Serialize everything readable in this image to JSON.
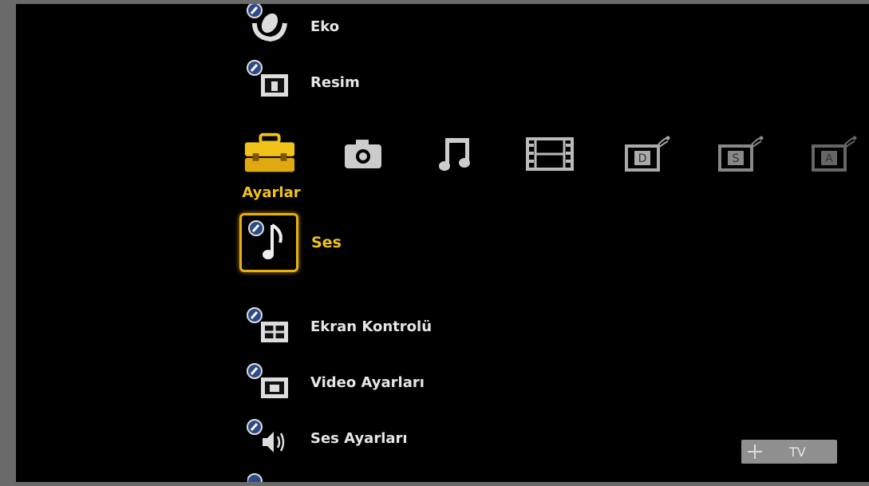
{
  "menu": {
    "items_above": [
      {
        "label": "Eko",
        "icon": "eco-leaf-icon"
      },
      {
        "label": "Resim",
        "icon": "picture-icon"
      }
    ],
    "selected": {
      "label": "Ses",
      "icon": "music-note-icon"
    },
    "items_below": [
      {
        "label": "Ekran Kontrolü",
        "icon": "screen-control-icon"
      },
      {
        "label": "Video Ayarları",
        "icon": "video-settings-icon"
      },
      {
        "label": "Ses Ayarları",
        "icon": "speaker-icon"
      }
    ]
  },
  "categories": {
    "active_label": "Ayarlar",
    "items": [
      {
        "name": "settings-toolbox-icon"
      },
      {
        "name": "camera-icon"
      },
      {
        "name": "music-icon"
      },
      {
        "name": "film-icon"
      },
      {
        "name": "digital-broadcast-icon",
        "text": "D"
      },
      {
        "name": "satellite-broadcast-icon",
        "text": "S"
      },
      {
        "name": "analog-broadcast-icon",
        "text": "A"
      }
    ]
  },
  "source_badge": {
    "label": "TV"
  },
  "colors": {
    "accent": "#f2c21a",
    "text": "#e6e6e6",
    "background": "#000000"
  }
}
